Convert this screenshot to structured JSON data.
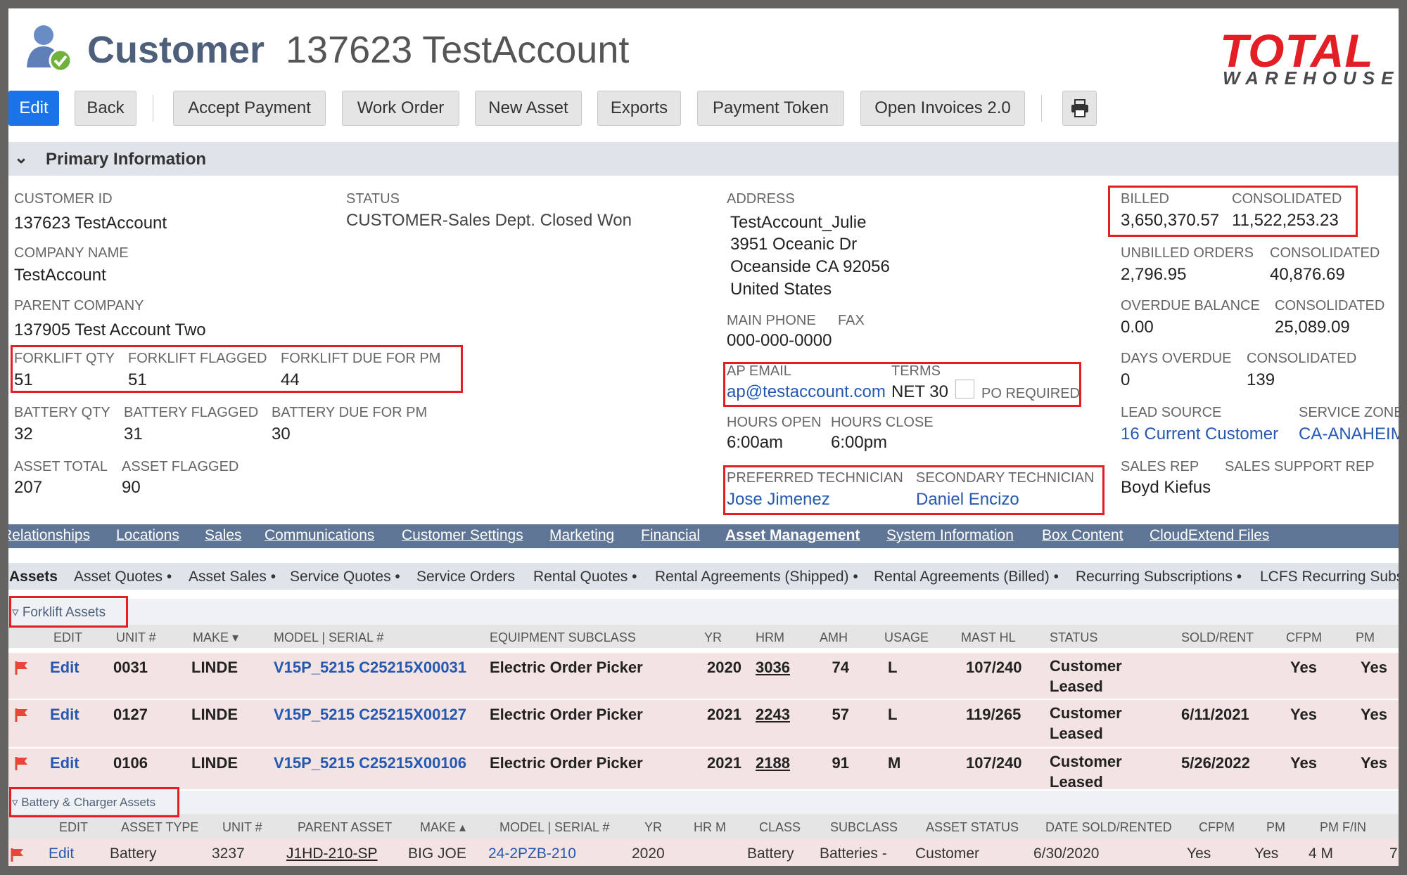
{
  "header": {
    "record_type": "Customer",
    "record_name": "137623 TestAccount",
    "logo_top": "TOTAL",
    "logo_bottom": "WAREHOUSE"
  },
  "toolbar": {
    "buttons": [
      "Edit",
      "Back",
      "Accept Payment",
      "Work Order",
      "New Asset",
      "Exports",
      "Payment Token",
      "Open Invoices 2.0"
    ],
    "print_icon": "printer-icon"
  },
  "primary": {
    "section_title": "Primary Information",
    "customer_id_label": "CUSTOMER ID",
    "customer_id": "137623 TestAccount",
    "company_name_label": "COMPANY NAME",
    "company_name": "TestAccount",
    "parent_company_label": "PARENT COMPANY",
    "parent_company": "137905 Test Account Two",
    "forklift_qty_label": "FORKLIFT QTY",
    "forklift_qty": "51",
    "forklift_flagged_label": "FORKLIFT FLAGGED",
    "forklift_flagged": "51",
    "forklift_due_label": "FORKLIFT DUE FOR PM",
    "forklift_due": "44",
    "battery_qty_label": "BATTERY QTY",
    "battery_qty": "32",
    "battery_flagged_label": "BATTERY FLAGGED",
    "battery_flagged": "31",
    "battery_due_label": "BATTERY DUE FOR PM",
    "battery_due": "30",
    "asset_total_label": "ASSET TOTAL",
    "asset_total": "207",
    "asset_flagged_label": "ASSET FLAGGED",
    "asset_flagged": "90",
    "status_label": "STATUS",
    "status": "CUSTOMER-Sales Dept. Closed Won",
    "address_label": "ADDRESS",
    "address": [
      "TestAccount_Julie",
      "3951 Oceanic Dr",
      "Oceanside CA 92056",
      "United States"
    ],
    "main_phone_label": "MAIN PHONE",
    "main_phone": "000-000-0000",
    "fax_label": "FAX",
    "ap_email_label": "AP EMAIL",
    "ap_email": "ap@testaccount.com",
    "terms_label": "TERMS",
    "terms": "NET 30",
    "po_required_label": "PO REQUIRED",
    "po_required": false,
    "hours_open_label": "HOURS OPEN",
    "hours_open": "6:00am",
    "hours_close_label": "HOURS CLOSE",
    "hours_close": "6:00pm",
    "pref_tech_label": "PREFERRED TECHNICIAN",
    "pref_tech": "Jose Jimenez",
    "sec_tech_label": "SECONDARY TECHNICIAN",
    "sec_tech": "Daniel Encizo",
    "billed_label": "BILLED",
    "billed": "3,650,370.57",
    "billed_cons_label": "CONSOLIDATED",
    "billed_cons": "11,522,253.23",
    "unbilled_label": "UNBILLED ORDERS",
    "unbilled": "2,796.95",
    "unbilled_cons_label": "CONSOLIDATED",
    "unbilled_cons": "40,876.69",
    "overdue_label": "OVERDUE BALANCE",
    "overdue": "0.00",
    "overdue_cons_label": "CONSOLIDATED",
    "overdue_cons": "25,089.09",
    "days_label": "DAYS OVERDUE",
    "days": "0",
    "days_cons_label": "CONSOLIDATED",
    "days_cons": "139",
    "lead_label": "LEAD SOURCE",
    "lead": "16 Current Customer",
    "zone_label": "SERVICE ZONE",
    "zone": "CA-ANAHEIM",
    "sales_rep_label": "SALES REP",
    "sales_rep": "Boyd Kiefus",
    "support_rep_label": "SALES SUPPORT REP"
  },
  "tabs": {
    "items": [
      "Relationships",
      "Locations",
      "Sales",
      "Communications",
      "Customer Settings",
      "Marketing",
      "Financial",
      "Asset Management",
      "System Information",
      "Box Content",
      "CloudExtend Files"
    ],
    "active": "Asset Management"
  },
  "subtabs": {
    "items": [
      "Assets",
      "Asset Quotes •",
      "Asset Sales •",
      "Service Quotes •",
      "Service Orders",
      "Rental Quotes •",
      "Rental Agreements (Shipped) •",
      "Rental Agreements (Billed) •",
      "Recurring Subscriptions •",
      "LCFS Recurring Subsc"
    ],
    "active": "Assets"
  },
  "forklift": {
    "title": "▿ Forklift Assets",
    "columns": [
      "EDIT",
      "UNIT #",
      "MAKE ▾",
      "MODEL | SERIAL #",
      "EQUIPMENT SUBCLASS",
      "YR",
      "HRM",
      "AMH",
      "USAGE",
      "MAST HL",
      "STATUS",
      "SOLD/RENT",
      "CFPM",
      "PM"
    ],
    "rows": [
      [
        "Edit",
        "0031",
        "LINDE",
        "V15P_5215 C25215X00031",
        "Electric Order Picker",
        "2020",
        "3036",
        "74",
        "L",
        "107/240",
        "Customer Leased",
        "",
        "Yes",
        "Yes"
      ],
      [
        "Edit",
        "0127",
        "LINDE",
        "V15P_5215 C25215X00127",
        "Electric Order Picker",
        "2021",
        "2243",
        "57",
        "L",
        "119/265",
        "Customer Leased",
        "6/11/2021",
        "Yes",
        "Yes"
      ],
      [
        "Edit",
        "0106",
        "LINDE",
        "V15P_5215 C25215X00106",
        "Electric Order Picker",
        "2021",
        "2188",
        "91",
        "M",
        "107/240",
        "Customer Leased",
        "5/26/2022",
        "Yes",
        "Yes"
      ]
    ]
  },
  "battery": {
    "title": "▿ Battery & Charger Assets",
    "columns": [
      "EDIT",
      "ASSET TYPE",
      "UNIT #",
      "PARENT ASSET",
      "MAKE ▴",
      "MODEL | SERIAL #",
      "YR",
      "HR M",
      "CLASS",
      "SUBCLASS",
      "ASSET STATUS",
      "DATE SOLD/RENTED",
      "CFPM",
      "PM",
      "PM F/IN"
    ],
    "rows": [
      [
        "Edit",
        "Battery",
        "3237",
        "J1HD-210-SP",
        "BIG JOE",
        "24-2PZB-210",
        "2020",
        "",
        "Battery",
        "Batteries -",
        "Customer",
        "6/30/2020",
        "Yes",
        "Yes",
        "4 M",
        "7"
      ]
    ]
  },
  "colors": {
    "accent": "#1a73e8",
    "tab_bar": "#5f7595",
    "highlight_box": "#e31e24",
    "flag": "#e8453c",
    "link": "#2558b0",
    "row_bg": "#f3e3e3"
  }
}
